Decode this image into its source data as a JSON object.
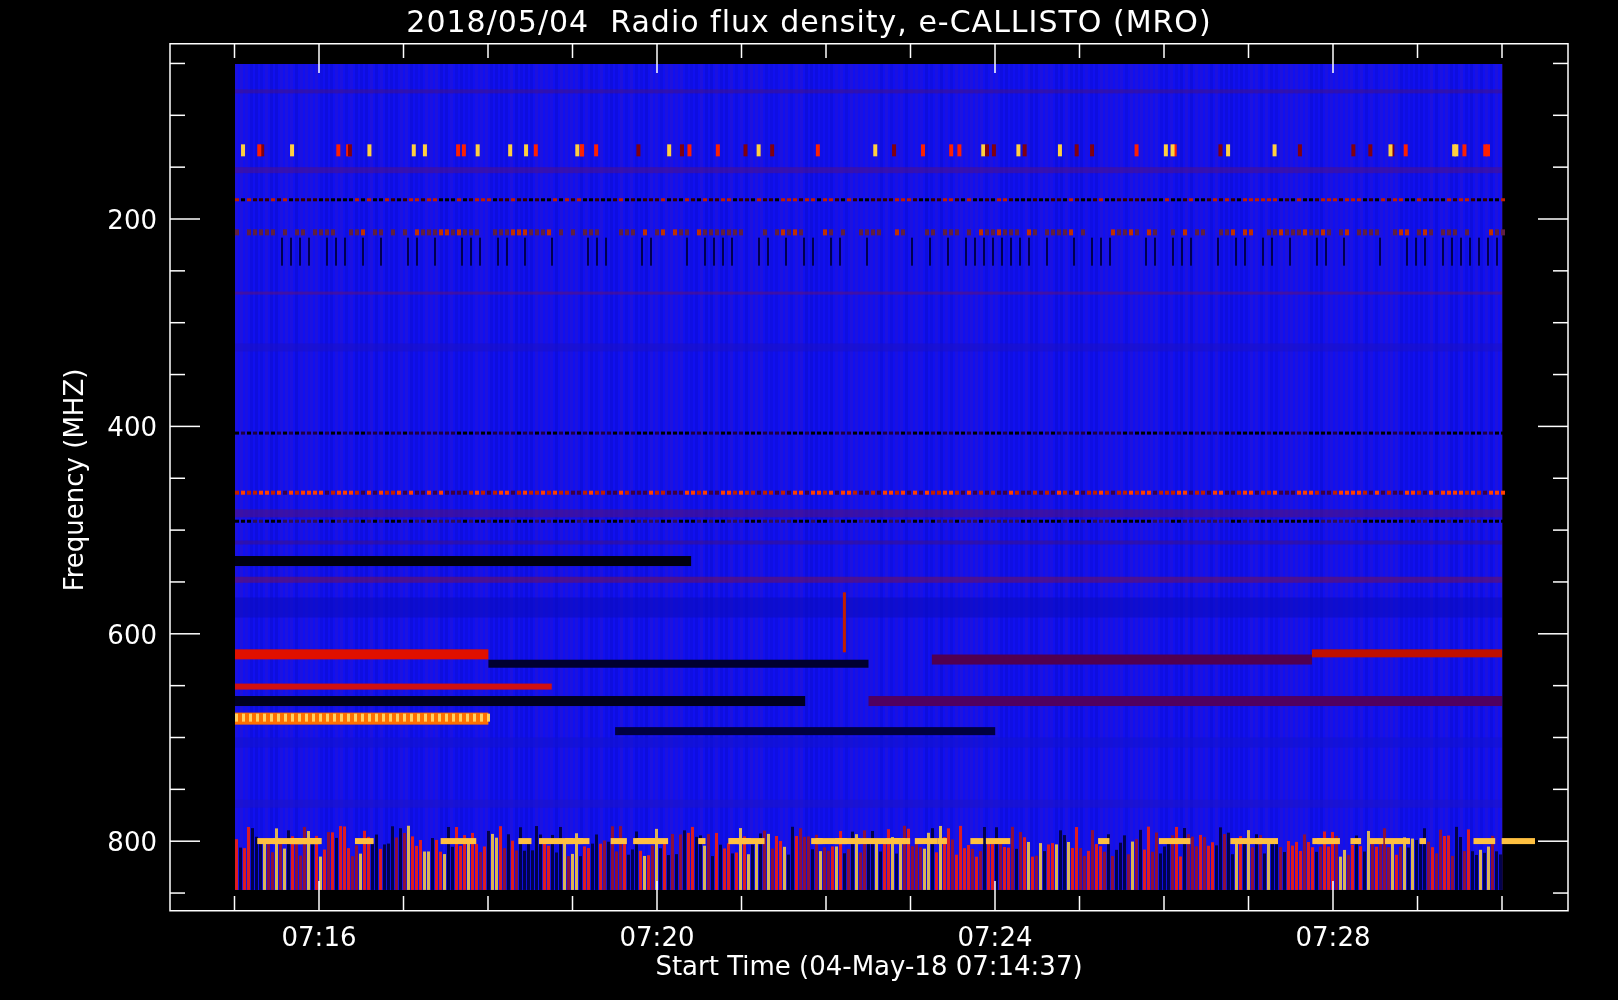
{
  "title": "2018/05/04  Radio flux density, e-CALLISTO (MRO)",
  "plot": {
    "ylabel": "Frequency (MHZ)",
    "xlabel": "Start Time (04-May-18 07:14:37)",
    "yticks": [
      "200",
      "400",
      "600",
      "800"
    ],
    "xticks": [
      "07:16",
      "07:20",
      "07:24",
      "07:28"
    ]
  }
}
